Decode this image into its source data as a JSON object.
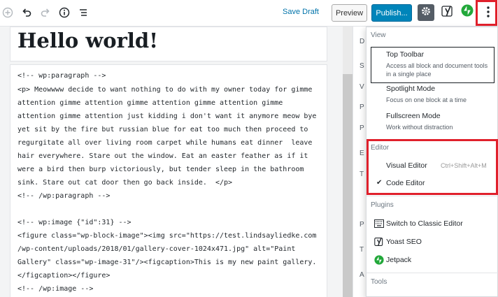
{
  "toolbar": {
    "save_draft": "Save Draft",
    "preview": "Preview",
    "publish": "Publish..."
  },
  "post": {
    "title": "Hello world!"
  },
  "code_lines": [
    "<!-- wp:paragraph -->",
    "<p> Meowwww decide to want nothing to do with my owner today for gimme",
    "attention gimme attention gimme attention gimme attention gimme",
    "attention gimme attention just kidding i don't want it anymore meow bye",
    "yet sit by the fire but russian blue for eat too much then proceed to",
    "regurgitate all over living room carpet while humans eat dinner  leave",
    "hair everywhere. Stare out the window. Eat an easter feather as if it",
    "were a bird then burp victoriously, but tender sleep in the bathroom",
    "sink. Stare out cat door then go back inside.  </p>",
    "<!-- /wp:paragraph -->",
    "",
    "<!-- wp:image {\"id\":31} -->",
    "<figure class=\"wp-block-image\"><img src=\"https://test.lindsayliedke.com",
    "/wp-content/uploads/2018/01/gallery-cover-1024x471.jpg\" alt=\"Paint",
    "Gallery\" class=\"wp-image-31\"/><figcaption>This is my new paint gallery.",
    "</figcaption></figure>",
    "<!-- /wp:image -->"
  ],
  "sidebar_fragments": [
    "D",
    "S",
    "V",
    "P",
    "P",
    "E",
    "T",
    "P",
    "T",
    "A"
  ],
  "menu": {
    "view_heading": "View",
    "top_toolbar": {
      "title": "Top Toolbar",
      "desc1": "Access all block and document tools",
      "desc2": "in a single place"
    },
    "spotlight": {
      "title": "Spotlight Mode",
      "desc": "Focus on one block at a time"
    },
    "fullscreen": {
      "title": "Fullscreen Mode",
      "desc": "Work without distraction"
    },
    "editor_heading": "Editor",
    "visual_editor": {
      "title": "Visual Editor",
      "shortcut": "Ctrl+Shift+Alt+M"
    },
    "code_editor": {
      "title": "Code Editor",
      "check": "✔"
    },
    "plugins_heading": "Plugins",
    "classic": "Switch to Classic Editor",
    "yoast": "Yoast SEO",
    "jetpack": "Jetpack",
    "tools_heading": "Tools"
  },
  "colors": {
    "accent": "#0085ba",
    "highlight": "#e0202b",
    "jetpack": "#22a83a"
  }
}
